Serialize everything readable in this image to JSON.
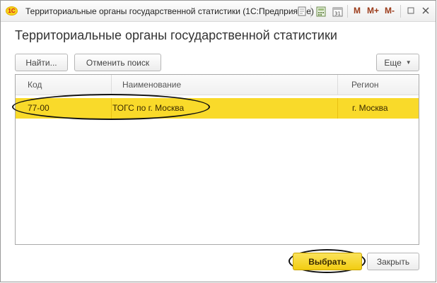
{
  "window": {
    "title": "Территориальные органы государственной статистики  (1С:Предприятие)",
    "logo_text": "1С",
    "memory_buttons": [
      "M",
      "M+",
      "M-"
    ],
    "calendar_day": "31"
  },
  "page": {
    "title": "Территориальные органы государственной статистики"
  },
  "toolbar": {
    "find_label": "Найти...",
    "cancel_search_label": "Отменить поиск",
    "more_label": "Еще"
  },
  "table": {
    "columns": [
      "Код",
      "Наименование",
      "Регион"
    ],
    "rows": [
      {
        "code": "77-00",
        "name": "ТОГС по г. Москва",
        "region": "г. Москва",
        "selected": true
      }
    ]
  },
  "footer": {
    "select_label": "Выбрать",
    "close_label": "Закрыть"
  },
  "colors": {
    "accent_yellow": "#f9da2a",
    "button_yellow": "#f2cd12",
    "annotation_outline": "#111111"
  }
}
